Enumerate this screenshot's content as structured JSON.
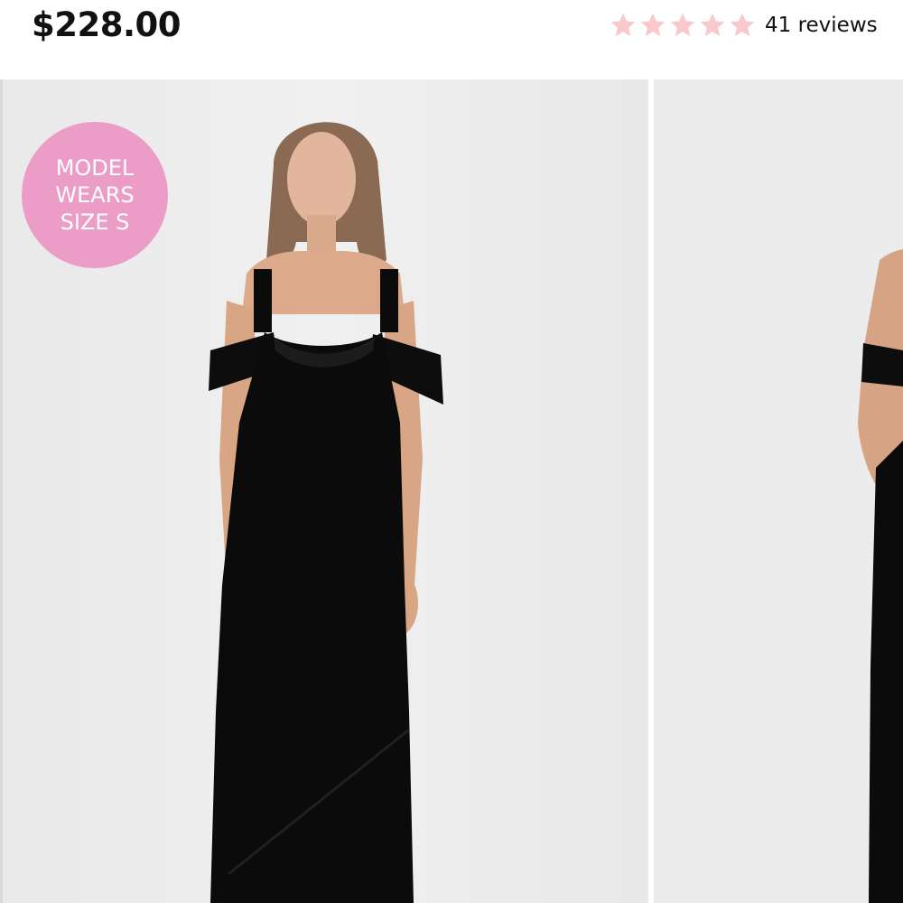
{
  "product": {
    "price": "$228.00"
  },
  "rating": {
    "stars": 5,
    "max_stars": 5,
    "star_color": "#f9c8cb",
    "star_icon": "star-icon",
    "reviews_label": "41 reviews"
  },
  "gallery": {
    "badge": {
      "line1": "MODEL",
      "line2": "WEARS",
      "line3": "SIZE S",
      "color": "#eb9dc7"
    },
    "photos": [
      {
        "name": "product-photo-front"
      },
      {
        "name": "product-photo-back"
      }
    ]
  },
  "colors": {
    "background": "#ffffff",
    "photo_background": "#ededed",
    "dress": "#0b0b0b",
    "text": "#111111"
  }
}
